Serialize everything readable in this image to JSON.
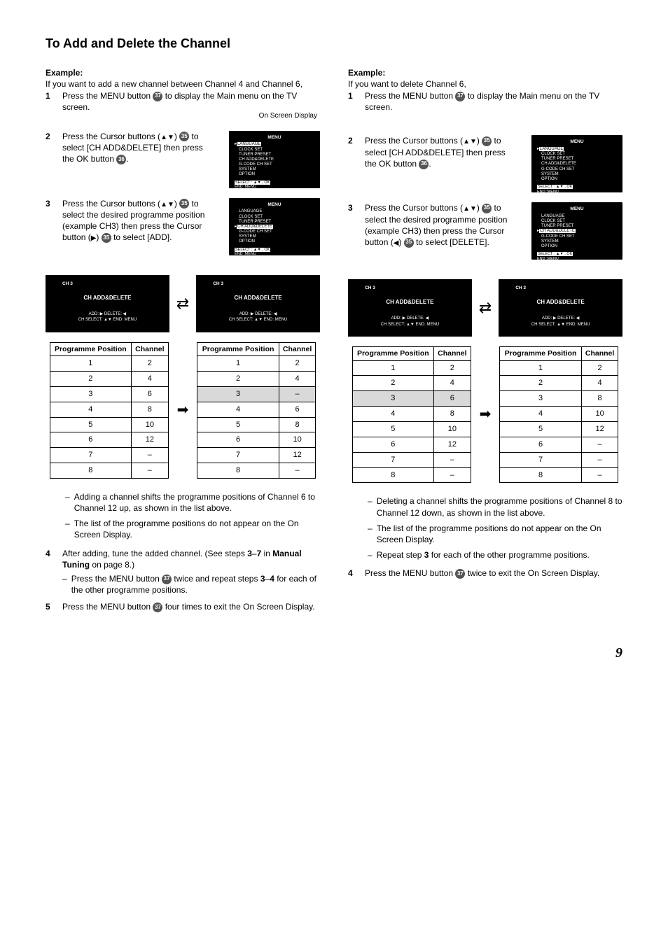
{
  "page": {
    "title": "To Add and Delete the Channel",
    "number": "9"
  },
  "ref": {
    "r37": "37",
    "r35": "35",
    "r36": "36"
  },
  "osd": {
    "osdLabel": "On Screen Display",
    "menuTitle": "MENU",
    "items": [
      "LANGUAGE",
      "CLOCK SET",
      "TUNER PRESET",
      "CH ADD&DELETE",
      "G-CODE CH SET",
      "SYSTEM",
      "OPTION"
    ],
    "footer1": "SELECT : ▲▼ , OK",
    "footer2": "END        :MENU"
  },
  "chOsd": {
    "ch": "CH 3",
    "title": "CH ADD&DELETE",
    "footBefore": "ADD: ▶   DELETE: ◀\nCH SELECT: ▲▼    END: MENU",
    "footAfter": "ADD: ▶   DELETE: ◀\nCH SELECT: ▲▼    END: MENU"
  },
  "tables": {
    "headPos": "Programme Position",
    "headCh": "Channel",
    "addBefore": [
      [
        "1",
        "2"
      ],
      [
        "2",
        "4"
      ],
      [
        "3",
        "6"
      ],
      [
        "4",
        "8"
      ],
      [
        "5",
        "10"
      ],
      [
        "6",
        "12"
      ],
      [
        "7",
        "–"
      ],
      [
        "8",
        "–"
      ]
    ],
    "addAfter": [
      [
        "1",
        "2"
      ],
      [
        "2",
        "4"
      ],
      [
        "3",
        "–"
      ],
      [
        "4",
        "6"
      ],
      [
        "5",
        "8"
      ],
      [
        "6",
        "10"
      ],
      [
        "7",
        "12"
      ],
      [
        "8",
        "–"
      ]
    ],
    "delBefore": [
      [
        "1",
        "2"
      ],
      [
        "2",
        "4"
      ],
      [
        "3",
        "6"
      ],
      [
        "4",
        "8"
      ],
      [
        "5",
        "10"
      ],
      [
        "6",
        "12"
      ],
      [
        "7",
        "–"
      ],
      [
        "8",
        "–"
      ]
    ],
    "delAfter": [
      [
        "1",
        "2"
      ],
      [
        "2",
        "4"
      ],
      [
        "3",
        "8"
      ],
      [
        "4",
        "10"
      ],
      [
        "5",
        "12"
      ],
      [
        "6",
        "–"
      ],
      [
        "7",
        "–"
      ],
      [
        "8",
        "–"
      ]
    ]
  },
  "left": {
    "exTitle": "Example:",
    "exText": "If you want to add a new channel between Channel 4 and Channel 6,",
    "s1": "Press the MENU button ",
    "s1b": " to display the Main menu on the TV screen.",
    "s2a": "Press the Cursor buttons (",
    "s2b": ") ",
    "s2c": " to select [CH ADD&DELETE] then press the OK button ",
    "s2d": ".",
    "s3a": "Press the Cursor buttons (",
    "s3b": ") ",
    "s3c": " to select the desired programme position (example CH3) then press the Cursor button (",
    "s3d": ") ",
    "s3e": " to select [ADD].",
    "n1": "Adding a channel shifts the programme positions of Channel 6 to Channel 12 up, as shown in the list above.",
    "n2": "The list of the programme positions do not appear on the On Screen Display.",
    "s4a": "After adding, tune the added channel. (See steps ",
    "s4b": "3",
    "s4c": "–",
    "s4d": "7",
    "s4e": " in ",
    "s4f": "Manual Tuning",
    "s4g": " on page 8.)",
    "s4n1a": "Press the MENU button ",
    "s4n1b": " twice and repeat steps ",
    "s4n1c": "3",
    "s4n1d": "–",
    "s4n1e": "4",
    "s4n1f": " for each of the other programme positions.",
    "s5a": "Press the MENU button ",
    "s5b": " four times to exit the On Screen Display."
  },
  "right": {
    "exTitle": "Example:",
    "exText": "If you want to delete Channel 6,",
    "s1": "Press the MENU button ",
    "s1b": " to display the Main menu on the TV screen.",
    "s2a": "Press the Cursor buttons (",
    "s2b": ") ",
    "s2c": " to select [CH ADD&DELETE] then press the OK button ",
    "s2d": ".",
    "s3a": "Press the Cursor buttons (",
    "s3b": ") ",
    "s3c": " to select the desired programme position (example CH3) then press the Cursor button (",
    "s3d": ") ",
    "s3e": " to select [DELETE].",
    "n1": "Deleting a channel shifts the programme positions of Channel 8 to Channel 12 down, as shown in the list above.",
    "n2": "The list of the programme positions do not appear on the On Screen Display.",
    "n3": "Repeat step ",
    "n3b": "3",
    "n3c": " for each of the other programme positions.",
    "s4a": "Press the MENU button ",
    "s4b": " twice to exit the On Screen Display."
  }
}
